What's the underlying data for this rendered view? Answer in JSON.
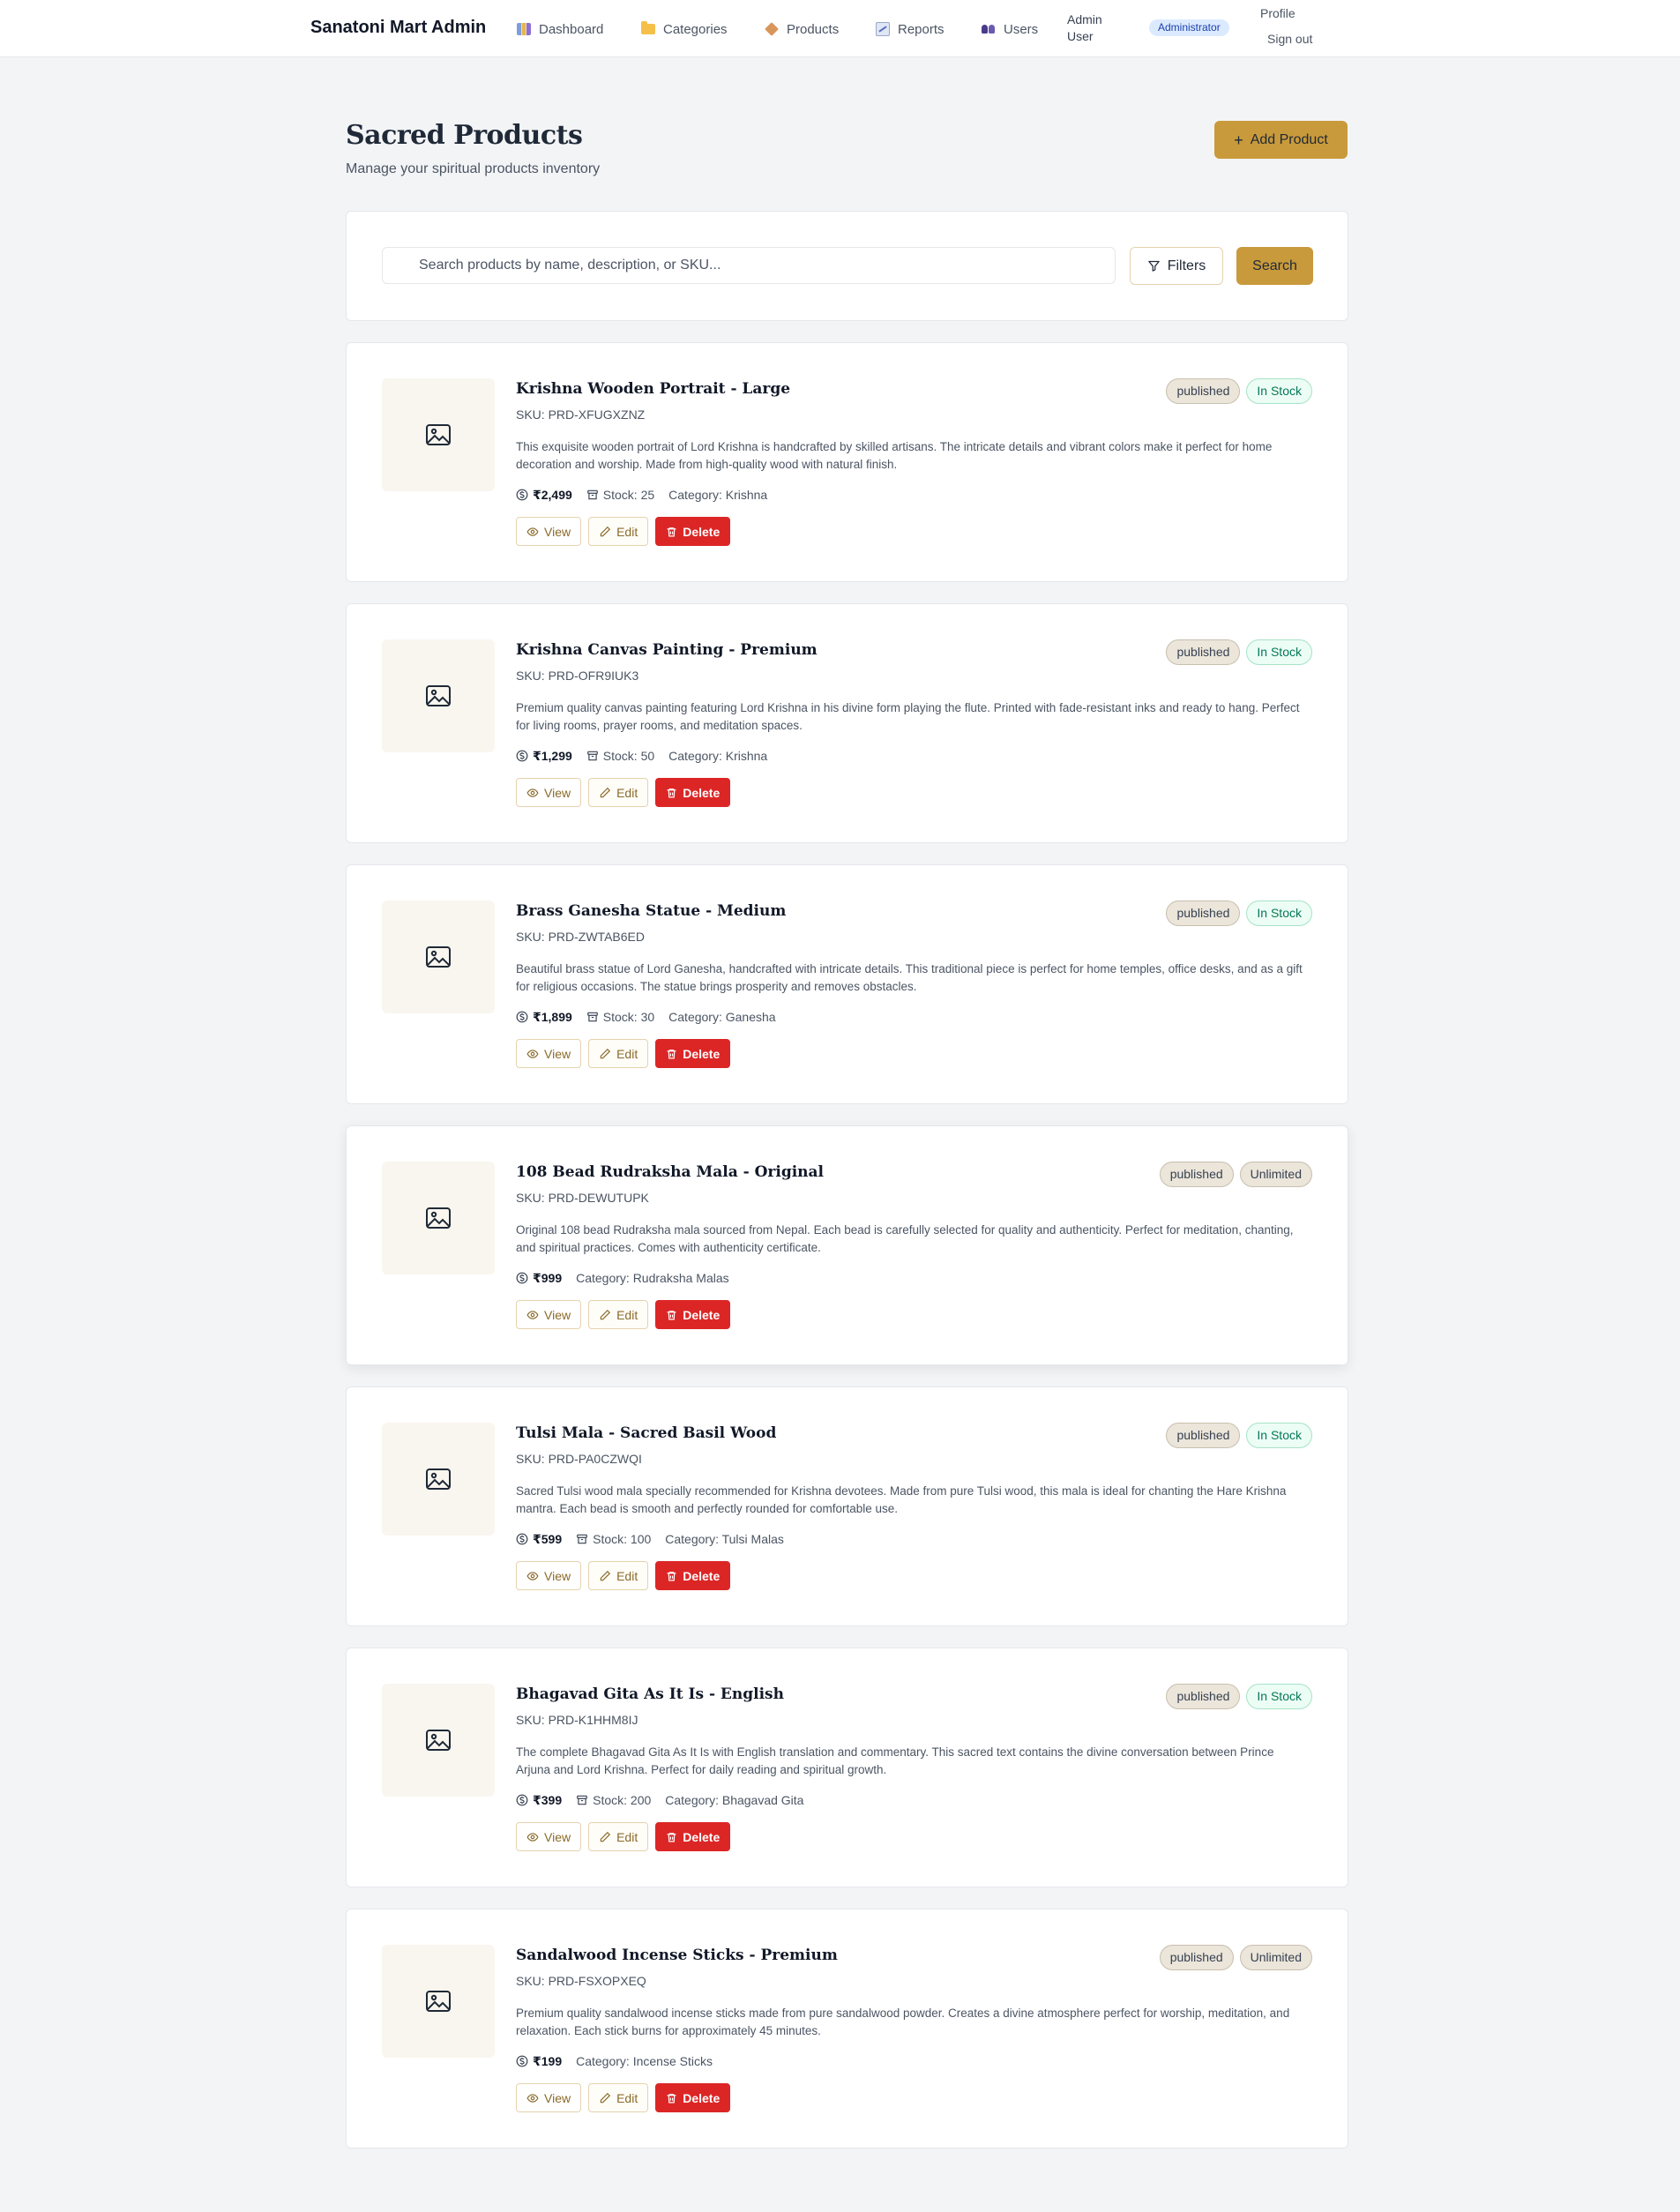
{
  "nav": {
    "brand": "Sanatoni Mart Admin",
    "items": [
      {
        "label": "Dashboard",
        "icon": "dashboard-icon"
      },
      {
        "label": "Categories",
        "icon": "folder-icon"
      },
      {
        "label": "Products",
        "icon": "box-icon"
      },
      {
        "label": "Reports",
        "icon": "report-icon"
      },
      {
        "label": "Users",
        "icon": "users-icon"
      }
    ],
    "user_name": "Admin User",
    "role": "Administrator",
    "profile": "Profile",
    "sign_out": "Sign out"
  },
  "header": {
    "title": "Sacred Products",
    "subtitle": "Manage your spiritual products inventory",
    "add_button": "Add Product"
  },
  "search": {
    "placeholder": "Search products by name, description, or SKU...",
    "filters_label": "Filters",
    "search_label": "Search"
  },
  "actions": {
    "view": "View",
    "edit": "Edit",
    "delete": "Delete"
  },
  "products": [
    {
      "title": "Krishna Wooden Portrait - Large",
      "sku": "SKU: PRD-XFUGXZNZ",
      "description": "This exquisite wooden portrait of Lord Krishna is handcrafted by skilled artisans. The intricate details and vibrant colors make it perfect for home decoration and worship. Made from high-quality wood with natural finish.",
      "price": "₹2,499",
      "stock": "Stock: 25",
      "category": "Category: Krishna",
      "status": "published",
      "stock_badge": "In Stock"
    },
    {
      "title": "Krishna Canvas Painting - Premium",
      "sku": "SKU: PRD-OFR9IUK3",
      "description": "Premium quality canvas painting featuring Lord Krishna in his divine form playing the flute. Printed with fade-resistant inks and ready to hang. Perfect for living rooms, prayer rooms, and meditation spaces.",
      "price": "₹1,299",
      "stock": "Stock: 50",
      "category": "Category: Krishna",
      "status": "published",
      "stock_badge": "In Stock"
    },
    {
      "title": "Brass Ganesha Statue - Medium",
      "sku": "SKU: PRD-ZWTAB6ED",
      "description": "Beautiful brass statue of Lord Ganesha, handcrafted with intricate details. This traditional piece is perfect for home temples, office desks, and as a gift for religious occasions. The statue brings prosperity and removes obstacles.",
      "price": "₹1,899",
      "stock": "Stock: 30",
      "category": "Category: Ganesha",
      "status": "published",
      "stock_badge": "In Stock"
    },
    {
      "title": "108 Bead Rudraksha Mala - Original",
      "sku": "SKU: PRD-DEWUTUPK",
      "description": "Original 108 bead Rudraksha mala sourced from Nepal. Each bead is carefully selected for quality and authenticity. Perfect for meditation, chanting, and spiritual practices. Comes with authenticity certificate.",
      "price": "₹999",
      "stock": "",
      "category": "Category: Rudraksha Malas",
      "status": "published",
      "stock_badge": "Unlimited"
    },
    {
      "title": "Tulsi Mala - Sacred Basil Wood",
      "sku": "SKU: PRD-PA0CZWQI",
      "description": "Sacred Tulsi wood mala specially recommended for Krishna devotees. Made from pure Tulsi wood, this mala is ideal for chanting the Hare Krishna mantra. Each bead is smooth and perfectly rounded for comfortable use.",
      "price": "₹599",
      "stock": "Stock: 100",
      "category": "Category: Tulsi Malas",
      "status": "published",
      "stock_badge": "In Stock"
    },
    {
      "title": "Bhagavad Gita As It Is - English",
      "sku": "SKU: PRD-K1HHM8IJ",
      "description": "The complete Bhagavad Gita As It Is with English translation and commentary. This sacred text contains the divine conversation between Prince Arjuna and Lord Krishna. Perfect for daily reading and spiritual growth.",
      "price": "₹399",
      "stock": "Stock: 200",
      "category": "Category: Bhagavad Gita",
      "status": "published",
      "stock_badge": "In Stock"
    },
    {
      "title": "Sandalwood Incense Sticks - Premium",
      "sku": "SKU: PRD-FSXOPXEQ",
      "description": "Premium quality sandalwood incense sticks made from pure sandalwood powder. Creates a divine atmosphere perfect for worship, meditation, and relaxation. Each stick burns for approximately 45 minutes.",
      "price": "₹199",
      "stock": "",
      "category": "Category: Incense Sticks",
      "status": "published",
      "stock_badge": "Unlimited"
    }
  ],
  "colors": {
    "accent": "#c99a3b",
    "danger": "#dc2626",
    "in_stock_text": "#047857",
    "page_bg": "#f3f4f6"
  }
}
